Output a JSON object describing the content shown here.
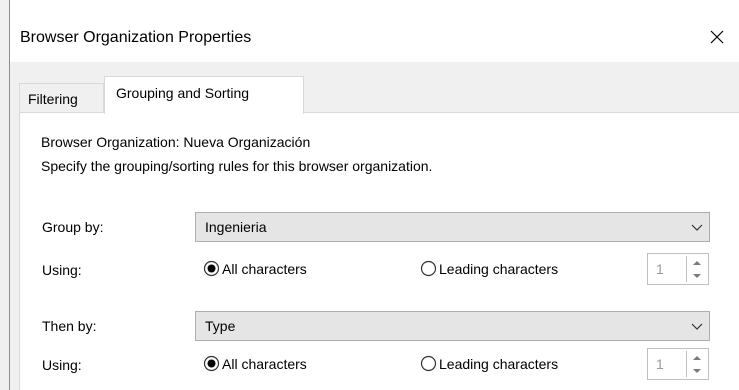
{
  "dialog": {
    "title": "Browser Organization Properties"
  },
  "tabs": [
    {
      "label": "Filtering"
    },
    {
      "label": "Grouping and Sorting"
    }
  ],
  "pane": {
    "heading": "Browser Organization: Nueva Organización",
    "description": "Specify the grouping/sorting rules for this browser organization."
  },
  "group_by": {
    "label": "Group by:",
    "value": "Ingenieria",
    "using_label": "Using:",
    "option_all": "All characters",
    "option_leading": "Leading characters",
    "selected": "All characters",
    "leading_count": "1"
  },
  "then_by": {
    "label": "Then by:",
    "value": "Type",
    "using_label": "Using:",
    "option_all": "All characters",
    "option_leading": "Leading characters",
    "selected": "All characters",
    "leading_count": "1"
  },
  "icons": {
    "close": "close-icon",
    "dropdown": "chevron-down-icon",
    "spinner_up": "chevron-up-icon",
    "spinner_down": "chevron-down-icon"
  },
  "colors": {
    "dialog_chrome": "#f0f0f0",
    "pane_background": "#ffffff",
    "combo_background": "#e5e5e5",
    "border": "#adadad"
  }
}
